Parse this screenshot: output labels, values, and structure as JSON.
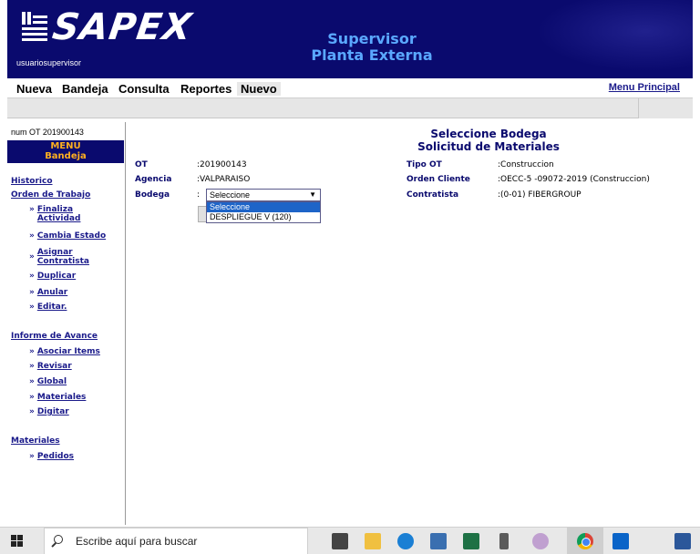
{
  "header": {
    "logo_text": "SAPEX",
    "user": "usuariosupervisor",
    "title_line1": "Supervisor",
    "title_line2": "Planta Externa"
  },
  "menubar": {
    "items": [
      "Nueva",
      "Bandeja",
      "Consulta",
      "Reportes",
      "Nuevo"
    ],
    "menu_principal": "Menu Principal"
  },
  "sidebar": {
    "num_ot": "num OT 201900143",
    "menu_label": "MENU",
    "menu_sub": "Bandeja",
    "historico": "Historico",
    "orden_trabajo": "Orden de Trabajo",
    "ot_items": [
      [
        "Finaliza",
        "Actividad"
      ],
      [
        "Cambia Estado"
      ],
      [
        "Asignar",
        "Contratista"
      ],
      [
        "Duplicar"
      ],
      [
        "Anular"
      ],
      [
        "Editar."
      ]
    ],
    "informe_avance": "Informe de Avance",
    "avance_items": [
      "Asociar Items",
      "Revisar",
      "Global",
      "Materiales",
      "Digitar"
    ],
    "materiales": "Materiales",
    "materiales_items": [
      "Pedidos"
    ],
    "raquo": "»"
  },
  "main": {
    "title_line1": "Seleccione Bodega",
    "title_line2": "Solicitud de Materiales",
    "left_fields": [
      {
        "label": "OT",
        "value": ":201900143"
      },
      {
        "label": "Agencia",
        "value": ":VALPARAISO"
      },
      {
        "label": "Bodega",
        "value": ":"
      }
    ],
    "right_fields": [
      {
        "label": "Tipo OT",
        "value": ":Construccion"
      },
      {
        "label": "Orden Cliente",
        "value": ":OECC-5 -09072-2019  (Construccion)"
      },
      {
        "label": "Contratista",
        "value": ":(0-01) FIBERGROUP"
      }
    ],
    "bodega_select": {
      "selected": "Seleccione",
      "options": [
        "Seleccione",
        "DESPLIEGUE V (120)"
      ]
    }
  },
  "taskbar": {
    "search_placeholder": "Escribe aquí para buscar",
    "icons": [
      "store-icon",
      "file-explorer-icon",
      "edge-icon",
      "app-icon",
      "excel-icon",
      "app2-icon",
      "paint-icon",
      "chrome-icon",
      "outlook-icon",
      "word-icon"
    ]
  },
  "colors": {
    "banner": "#0a0a6e",
    "accent": "#1a1a8a",
    "menu_orange": "#ffb020",
    "title_blue": "#5aa8ff",
    "select_highlight": "#1e64c8"
  }
}
